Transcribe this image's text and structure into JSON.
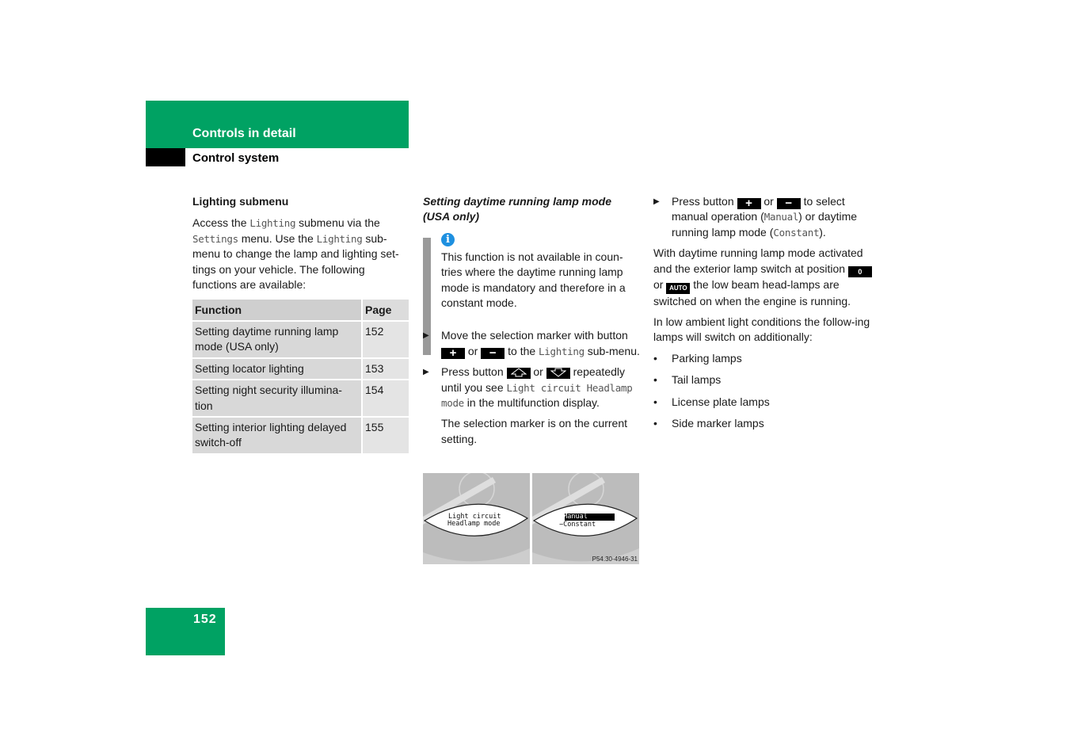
{
  "header": {
    "section_title": "Controls in detail",
    "subsection_title": "Control system",
    "accent_color": "#00a263"
  },
  "col1": {
    "heading": "Lighting submenu",
    "intro": {
      "t1": "Access the ",
      "m1": "Lighting",
      "t2": " submenu via the ",
      "m2": "Settings",
      "t3": " menu. Use the ",
      "m3": "Lighting",
      "t4": " sub-menu to change the lamp and lighting set-tings on your vehicle. The following functions are available:"
    },
    "table": {
      "headers": [
        "Function",
        "Page"
      ],
      "rows": [
        {
          "function": "Setting daytime running lamp mode (USA only)",
          "page": "152"
        },
        {
          "function": "Setting locator lighting",
          "page": "153"
        },
        {
          "function": "Setting night security illumina-tion",
          "page": "154"
        },
        {
          "function": "Setting interior lighting delayed switch-off",
          "page": "155"
        }
      ]
    }
  },
  "col2": {
    "heading": "Setting daytime running lamp mode (USA only)",
    "note": {
      "icon": "info-icon",
      "text": "This function is not available in coun-tries where the daytime running lamp mode is mandatory and therefore in a constant mode."
    },
    "step1": {
      "t1": "Move the selection marker with button ",
      "key1": "+",
      "t2": " or ",
      "key2": "−",
      "t3": " to the ",
      "m1": "Lighting",
      "t4": " sub-menu."
    },
    "step2": {
      "t1": "Press button ",
      "key1": "up-arrow-key",
      "t2": " or ",
      "key2": "down-arrow-key",
      "t3": " repeatedly until you see ",
      "m1": "Light circuit Headlamp mode",
      "t4": " in the multifunction display."
    },
    "step2_result": "The selection marker is on the current setting.",
    "figure": {
      "left_display": [
        "Light circuit",
        "Headlamp mode"
      ],
      "right_display": [
        {
          "marker": "+",
          "label": "Manual",
          "selected": true
        },
        {
          "marker": "−",
          "label": "Constant",
          "selected": false
        }
      ],
      "code": "P54.30-4946-31"
    }
  },
  "col3": {
    "step": {
      "t1": "Press button ",
      "key1": "+",
      "t2": " or ",
      "key2": "−",
      "t3": " to select manual operation (",
      "m1": "Manual",
      "t4": ") or daytime running lamp mode (",
      "m2": "Constant",
      "t5": ")."
    },
    "para1": {
      "t1": "With daytime running lamp mode activated and the exterior lamp switch at position ",
      "key1": "0",
      "t2": " or ",
      "key2": "AUTO",
      "t3": " the low beam head-lamps are switched on when the engine is running."
    },
    "para2": "In low ambient light conditions the follow-ing lamps will switch on additionally:",
    "bullets": [
      "Parking lamps",
      "Tail lamps",
      "License plate lamps",
      "Side marker lamps"
    ]
  },
  "footer": {
    "page_number": "152"
  }
}
